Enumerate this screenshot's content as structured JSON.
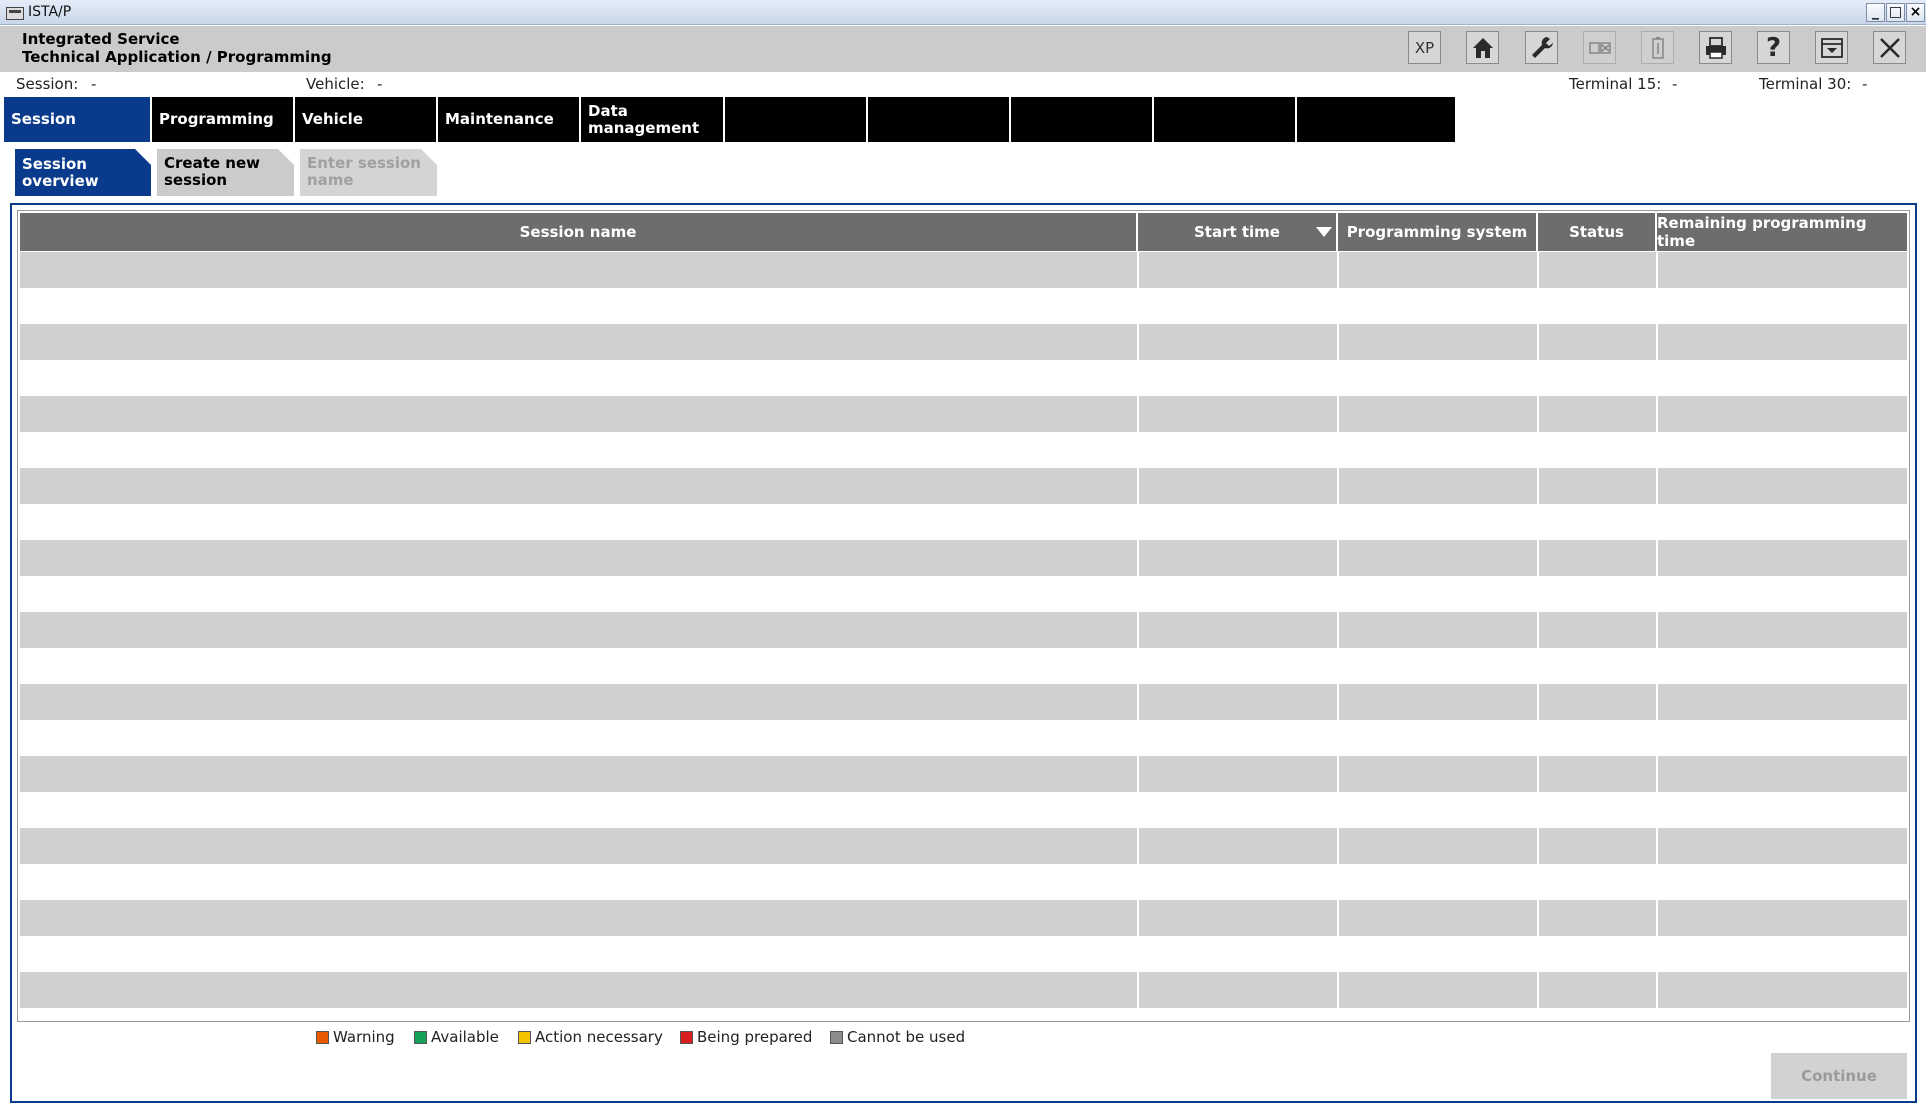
{
  "window": {
    "title": "ISTA/P",
    "minimize": "_",
    "maximize": "□",
    "close": "×"
  },
  "header": {
    "product_line1": "Integrated Service",
    "product_line2": "Technical Application / Programming",
    "tools": [
      {
        "name": "xp-button",
        "label": "XP"
      },
      {
        "name": "home-icon"
      },
      {
        "name": "wrench-icon"
      },
      {
        "name": "vehicle-info-icon"
      },
      {
        "name": "battery-icon"
      },
      {
        "name": "print-icon"
      },
      {
        "name": "help-icon",
        "label": "?"
      },
      {
        "name": "minimize-panel-icon"
      },
      {
        "name": "close-app-icon"
      }
    ]
  },
  "info": {
    "session_label": "Session:",
    "session_value": "-",
    "vehicle_label": "Vehicle:",
    "vehicle_value": "-",
    "terminal15_label": "Terminal 15:",
    "terminal15_value": "-",
    "terminal30_label": "Terminal 30:",
    "terminal30_value": "-"
  },
  "main_tabs": [
    {
      "label": "Session",
      "active": true
    },
    {
      "label": "Programming"
    },
    {
      "label": "Vehicle"
    },
    {
      "label": "Maintenance"
    },
    {
      "label": "Data management"
    },
    {
      "label": ""
    },
    {
      "label": ""
    },
    {
      "label": ""
    },
    {
      "label": ""
    },
    {
      "label": ""
    }
  ],
  "sub_tabs": [
    {
      "label": "Session overview",
      "state": "active"
    },
    {
      "label": "Create new session",
      "state": "normal"
    },
    {
      "label": "Enter session name",
      "state": "disabled"
    }
  ],
  "table": {
    "columns": [
      "Session name",
      "Start time",
      "Programming system",
      "Status",
      "Remaining programming time"
    ],
    "sort_column": "Start time",
    "sort_direction": "descending",
    "rows": []
  },
  "legend": [
    {
      "label": "Warning",
      "color": "#e85a00"
    },
    {
      "label": "Available",
      "color": "#17a05a"
    },
    {
      "label": "Action necessary",
      "color": "#f5c400"
    },
    {
      "label": "Being prepared",
      "color": "#d81e1e"
    },
    {
      "label": "Cannot be used",
      "color": "#8c8c8c"
    }
  ],
  "footer": {
    "continue_label": "Continue"
  },
  "colors": {
    "accent": "#0a3a8c",
    "tab_black": "#000000",
    "header_gray": "#cbcbcb",
    "table_header": "#6d6d6d",
    "row_shade": "#d0d0d0"
  }
}
